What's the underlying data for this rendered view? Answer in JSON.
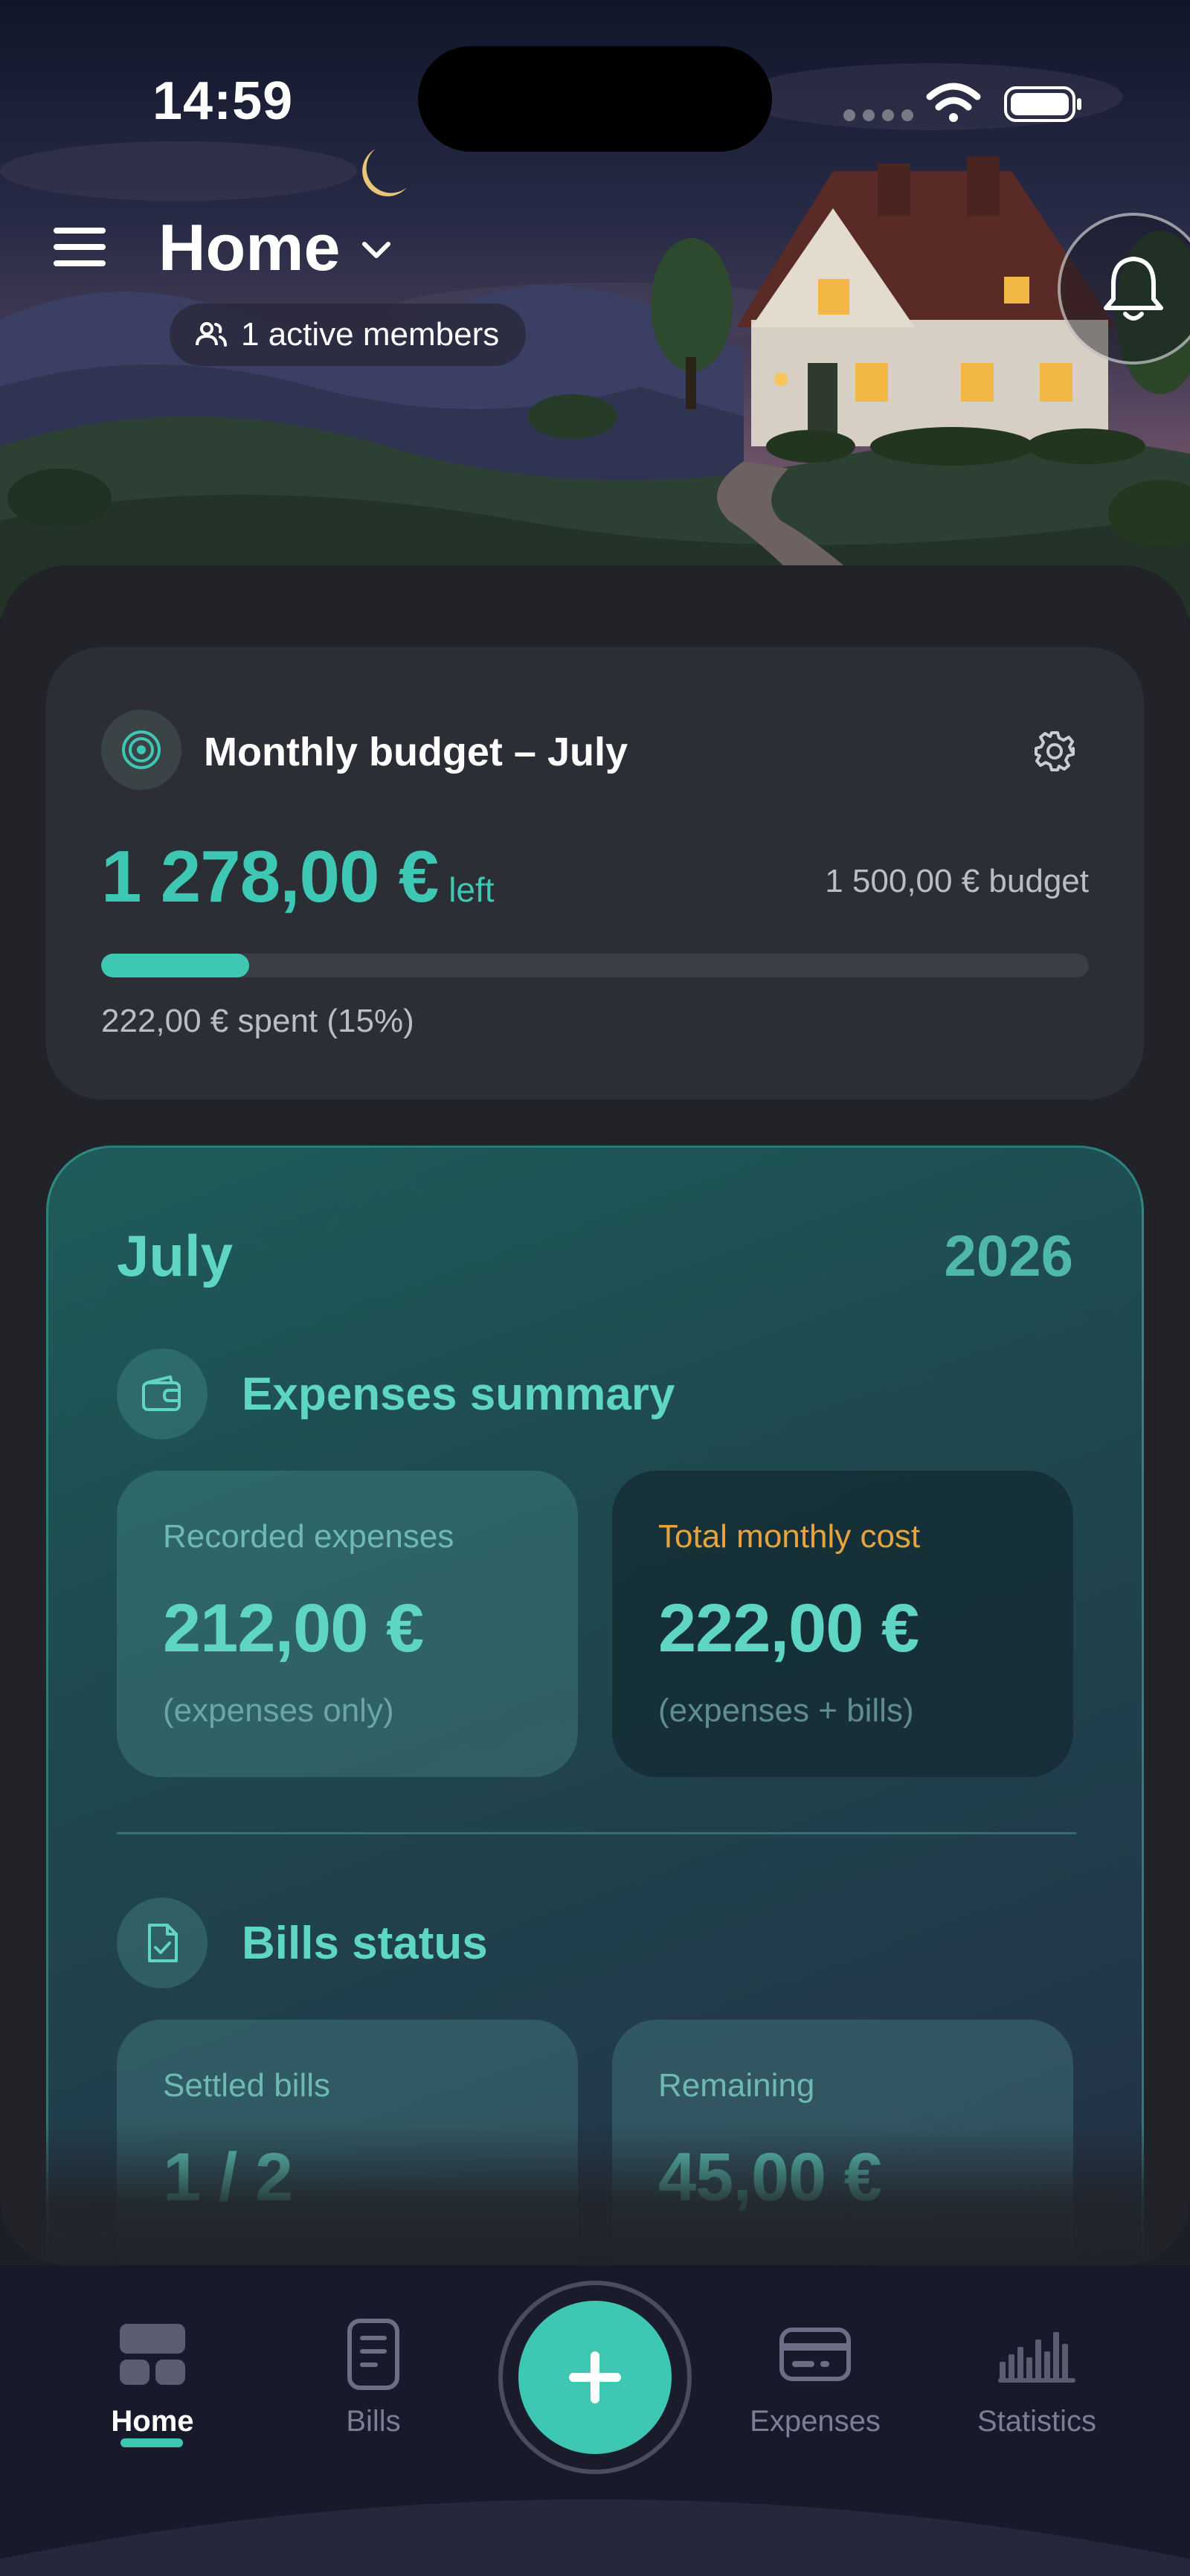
{
  "status_bar": {
    "time": "14:59"
  },
  "header": {
    "title": "Home",
    "members_label": "1 active members"
  },
  "budget": {
    "title": "Monthly budget – July",
    "left_amount": "1 278,00 €",
    "left_suffix": "left",
    "total_label": "1 500,00 € budget",
    "spent_label": "222,00 € spent (15%)",
    "spent_fraction": 0.15
  },
  "month_card": {
    "month": "July",
    "year": "2026",
    "expenses_section": {
      "title": "Expenses summary",
      "recorded": {
        "caption": "Recorded expenses",
        "value": "212,00 €",
        "note": "(expenses only)"
      },
      "total": {
        "caption": "Total monthly cost",
        "value": "222,00 €",
        "note": "(expenses + bills)"
      }
    },
    "bills_section": {
      "title": "Bills status",
      "settled": {
        "caption": "Settled bills",
        "value": "1 / 2"
      },
      "remaining": {
        "caption": "Remaining",
        "value": "45,00 €"
      }
    }
  },
  "nav": {
    "items": [
      {
        "label": "Home",
        "icon": "home-grid-icon"
      },
      {
        "label": "Bills",
        "icon": "bill-document-icon"
      },
      {
        "label": "Expenses",
        "icon": "credit-card-icon"
      },
      {
        "label": "Statistics",
        "icon": "bar-chart-icon"
      }
    ],
    "active": "Home",
    "fab_icon": "plus-icon"
  },
  "colors": {
    "accent": "#3ec8b4",
    "accent_text": "#5fd6c4",
    "orange": "#e8a43c",
    "card": "#2c2e36",
    "sheet": "#212329"
  }
}
